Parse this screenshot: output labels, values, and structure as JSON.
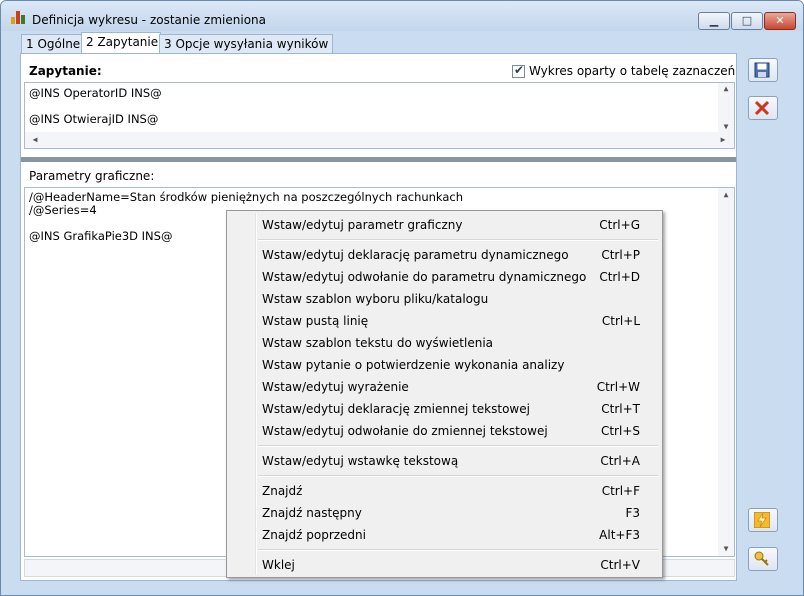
{
  "window": {
    "title": "Definicja wykresu - zostanie zmieniona"
  },
  "tabs": [
    "1 Ogólne",
    "2 Zapytanie",
    "3 Opcje wysyłania wyników"
  ],
  "query_section": {
    "label": "Zapytanie:",
    "checkbox_label": "Wykres oparty o tabelę zaznaczeń",
    "checkbox_checked": true,
    "lines": [
      "@INS OperatorID INS@",
      "",
      "@INS OtwierajID INS@"
    ]
  },
  "graphic_section": {
    "label": "Parametry graficzne:",
    "lines": [
      "/@HeaderName=Stan środków pieniężnych na poszczególnych rachunkach",
      "/@Series=4",
      "",
      "@INS GrafikaPie3D INS@"
    ]
  },
  "context_menu": {
    "groups": [
      [
        {
          "label": "Wstaw/edytuj parametr graficzny",
          "shortcut": "Ctrl+G"
        }
      ],
      [
        {
          "label": "Wstaw/edytuj deklarację parametru dynamicznego",
          "shortcut": "Ctrl+P"
        },
        {
          "label": "Wstaw/edytuj odwołanie do parametru dynamicznego",
          "shortcut": "Ctrl+D"
        },
        {
          "label": "Wstaw szablon wyboru pliku/katalogu",
          "shortcut": ""
        },
        {
          "label": "Wstaw pustą linię",
          "shortcut": "Ctrl+L"
        },
        {
          "label": "Wstaw szablon tekstu do wyświetlenia",
          "shortcut": ""
        },
        {
          "label": "Wstaw pytanie o potwierdzenie wykonania analizy",
          "shortcut": ""
        },
        {
          "label": "Wstaw/edytuj wyrażenie",
          "shortcut": "Ctrl+W"
        },
        {
          "label": "Wstaw/edytuj deklarację zmiennej tekstowej",
          "shortcut": "Ctrl+T"
        },
        {
          "label": "Wstaw/edytuj odwołanie do zmiennej tekstowej",
          "shortcut": "Ctrl+S"
        }
      ],
      [
        {
          "label": "Wstaw/edytuj wstawkę tekstową",
          "shortcut": "Ctrl+A"
        }
      ],
      [
        {
          "label": "Znajdź",
          "shortcut": "Ctrl+F"
        },
        {
          "label": "Znajdź następny",
          "shortcut": "F3"
        },
        {
          "label": "Znajdź poprzedni",
          "shortcut": "Alt+F3"
        }
      ],
      [
        {
          "label": "Wklej",
          "shortcut": "Ctrl+V"
        }
      ]
    ]
  },
  "side_buttons": [
    "save-icon",
    "delete-icon",
    "lightning-icon",
    "key-icon"
  ],
  "colors": {
    "titlebar": "#c3d6ec",
    "close": "#c8462f",
    "menu_bg": "#f0f0f0"
  }
}
